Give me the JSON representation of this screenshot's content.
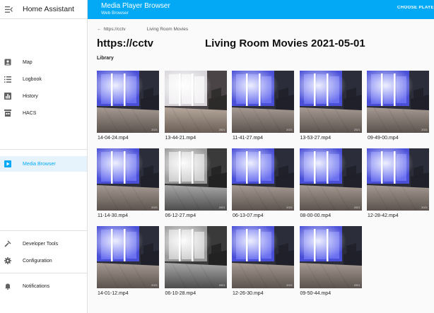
{
  "sidebar": {
    "app_title": "Home Assistant",
    "items": [
      {
        "label": "Map",
        "icon": "account-box-icon"
      },
      {
        "label": "Logbook",
        "icon": "list-icon"
      },
      {
        "label": "History",
        "icon": "chart-bar-icon"
      },
      {
        "label": "HACS",
        "icon": "hacs-store-icon"
      },
      {
        "label": "Media Browser",
        "icon": "media-play-box-icon",
        "active": true
      },
      {
        "label": "Developer Tools",
        "icon": "hammer-icon"
      },
      {
        "label": "Configuration",
        "icon": "gear-icon"
      },
      {
        "label": "Notifications",
        "icon": "bell-icon"
      }
    ]
  },
  "header": {
    "title": "Media Player Browser",
    "subtitle": "Web Browser",
    "choose_player": "CHOOSE PLAYER"
  },
  "main": {
    "breadcrumb_back": "https://cctv",
    "breadcrumb_current": "Living Room Movies",
    "title": "https://cctv",
    "subtitle": "Living Room Movies 2021-05-01",
    "section": "Library",
    "items": [
      {
        "name": "14-04-24.mp4",
        "style": "blue"
      },
      {
        "name": "13-44-21.mp4",
        "style": "warm"
      },
      {
        "name": "11-41-27.mp4",
        "style": "blue"
      },
      {
        "name": "13-53-27.mp4",
        "style": "blue"
      },
      {
        "name": "09-49-00.mp4",
        "style": "blue"
      },
      {
        "name": "11-14-30.mp4",
        "style": "blue"
      },
      {
        "name": "06-12-27.mp4",
        "style": "gray"
      },
      {
        "name": "06-13-07.mp4",
        "style": "blue"
      },
      {
        "name": "08-00-00.mp4",
        "style": "blue"
      },
      {
        "name": "12-28-42.mp4",
        "style": "blue"
      },
      {
        "name": "14-01-12.mp4",
        "style": "blue"
      },
      {
        "name": "06-10-28.mp4",
        "style": "gray"
      },
      {
        "name": "12-26-30.mp4",
        "style": "blue"
      },
      {
        "name": "09-50-44.mp4",
        "style": "blue"
      }
    ],
    "thumb_badge": "2021"
  }
}
